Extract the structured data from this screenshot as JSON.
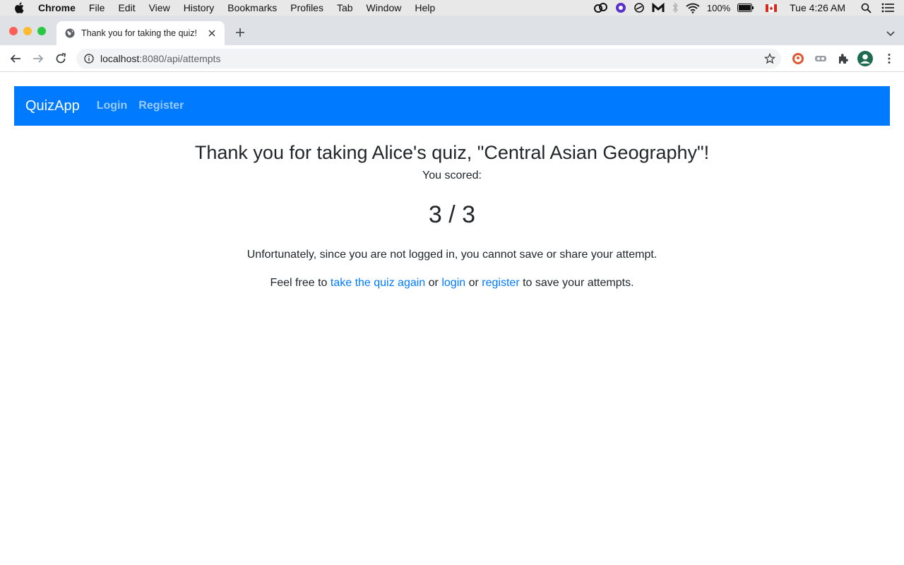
{
  "menubar": {
    "app": "Chrome",
    "items": [
      "File",
      "Edit",
      "View",
      "History",
      "Bookmarks",
      "Profiles",
      "Tab",
      "Window",
      "Help"
    ],
    "battery": "100%",
    "clock": "Tue 4:26 AM"
  },
  "browser": {
    "tab_title": "Thank you for taking the quiz!",
    "url_host": "localhost",
    "url_path": ":8080/api/attempts"
  },
  "navbar": {
    "brand": "QuizApp",
    "login": "Login",
    "register": "Register",
    "bg_color": "#007bff"
  },
  "result": {
    "heading": "Thank you for taking Alice's quiz, \"Central Asian Geography\"!",
    "scored_label": "You scored:",
    "score": "3 / 3",
    "message": "Unfortunately, since you are not logged in, you cannot save or share your attempt.",
    "cta_prefix": "Feel free to",
    "cta_retake": "take the quiz again",
    "cta_or1": "or",
    "cta_login": "login",
    "cta_or2": "or",
    "cta_register": "register",
    "cta_suffix": "to save your attempts."
  }
}
